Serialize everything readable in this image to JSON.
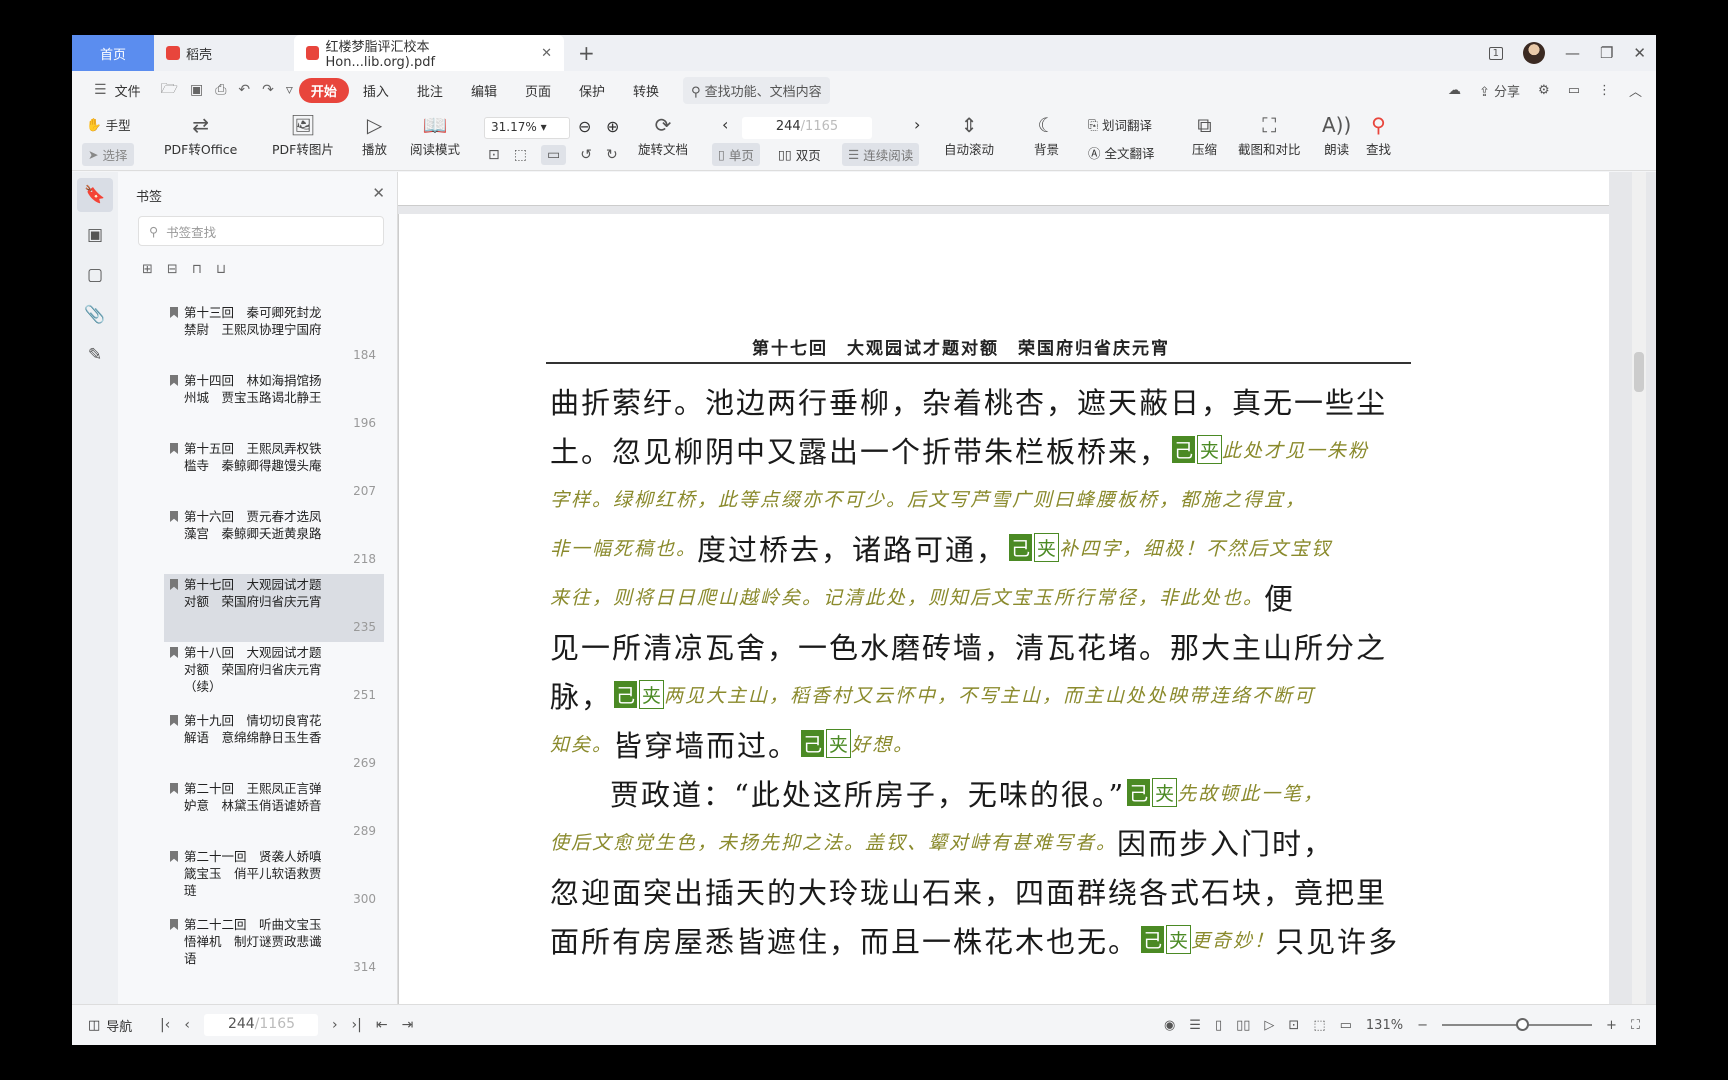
{
  "tabs": {
    "home": "首页",
    "docer": "稻壳",
    "pdf": "红楼梦脂评汇校本 Hon...lib.org).pdf"
  },
  "window": {
    "badge": "1"
  },
  "menu": {
    "file": "文件",
    "items": [
      "开始",
      "插入",
      "批注",
      "编辑",
      "页面",
      "保护",
      "转换"
    ],
    "search": "查找功能、文档内容",
    "share": "分享"
  },
  "toolbar": {
    "hand": "手型",
    "select": "选择",
    "pdf_to_office": "PDF转Office",
    "pdf_to_image": "PDF转图片",
    "play": "播放",
    "reading_mode": "阅读模式",
    "zoom": "31.17%",
    "rotate": "旋转文档",
    "page_current": "244",
    "page_total": "/1165",
    "single": "单页",
    "double": "双页",
    "continuous": "连续阅读",
    "auto_scroll": "自动滚动",
    "background": "背景",
    "word_translate": "划词翻译",
    "full_translate": "全文翻译",
    "compress": "压缩",
    "screenshot_compare": "截图和对比",
    "read_aloud": "朗读",
    "find": "查找"
  },
  "bookmarks": {
    "title": "书签",
    "search_placeholder": "书签查找",
    "items": [
      {
        "label": "第十三回　秦可卿死封龙禁尉　王熙凤协理宁国府",
        "page": "184"
      },
      {
        "label": "第十四回　林如海捐馆扬州城　贾宝玉路谒北静王",
        "page": "196"
      },
      {
        "label": "第十五回　王熙凤弄权铁槛寺　秦鲸卿得趣馒头庵",
        "page": "207"
      },
      {
        "label": "第十六回　贾元春才选凤藻宫　秦鲸卿夭逝黄泉路",
        "page": "218"
      },
      {
        "label": "第十七回　大观园试才题对额　荣国府归省庆元宵",
        "page": "235"
      },
      {
        "label": "第十八回　大观园试才题对额　荣国府归省庆元宵（续）",
        "page": "251"
      },
      {
        "label": "第十九回　情切切良宵花解语　意绵绵静日玉生香",
        "page": "269"
      },
      {
        "label": "第二十回　王熙凤正言弹妒意　林黛玉俏语谑娇音",
        "page": "289"
      },
      {
        "label": "第二十一回　贤袭人娇嗔箴宝玉　俏平儿软语救贾琏",
        "page": "300"
      },
      {
        "label": "第二十二回　听曲文宝玉悟禅机　制灯谜贾政悲谶语",
        "page": "314"
      }
    ]
  },
  "document": {
    "running_head": "第十七回　大观园试才题对额　荣国府归省庆元宵",
    "tag": "己",
    "tag2": "夹",
    "lines": {
      "l1": "曲折萦纡。池边两行垂柳，杂着桃杏，遮天蔽日，真无一些尘",
      "l2a": "土。忽见柳阴中又露出一个折带朱栏板桥来，",
      "l2b": "此处才见一朱粉",
      "l3": "字样。绿柳红桥，此等点缀亦不可少。后文写芦雪广则曰蜂腰板桥，都施之得宜，",
      "l4a": "非一幅死稿也。",
      "l4b": "度过桥去，诸路可通，",
      "l4c": "补四字，细极！不然后文宝钗",
      "l5a": "来往，则将日日爬山越岭矣。记清此处，则知后文宝玉所行常径，非此处也。",
      "l5b": "便",
      "l6": "见一所清凉瓦舍，一色水磨砖墙，清瓦花堵。那大主山所分之",
      "l7a": "脉，",
      "l7b": "两见大主山，稻香村又云怀中，不写主山，而主山处处映带连络不断可",
      "l8a": "知矣。",
      "l8b": "皆穿墙而过。",
      "l8c": "好想。",
      "l9a": "贾政道：“此处这所房子，无味的很。”",
      "l9b": "先故顿此一笔，",
      "l10a": "使后文愈觉生色，未扬先抑之法。盖钗、颦对峙有甚难写者。",
      "l10b": "因而步入门时，",
      "l11": "忽迎面突出插天的大玲珑山石来，四面群绕各式石块，竟把里",
      "l12a": "面所有房屋悉皆遮住，而且一株花木也无。",
      "l12b": "更奇妙！",
      "l12c": "只见许多"
    }
  },
  "statusbar": {
    "nav": "导航",
    "page_current": "244",
    "page_total": "/1165",
    "zoom": "131%"
  },
  "colors": {
    "accent": "#e8453c",
    "home_tab": "#5b8def",
    "annotation_tag": "#4b8a24"
  }
}
